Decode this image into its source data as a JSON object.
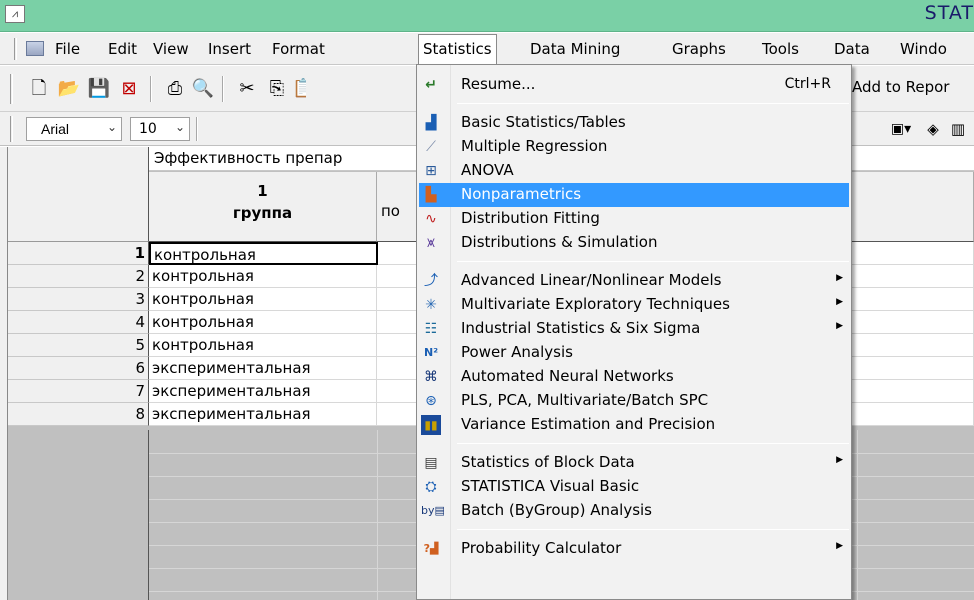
{
  "window": {
    "title": "STAT"
  },
  "menubar": {
    "items": [
      "File",
      "Edit",
      "View",
      "Insert",
      "Format",
      "Statistics",
      "Data Mining",
      "Graphs",
      "Tools",
      "Data",
      "Windo"
    ]
  },
  "toolbar": {
    "add_to_report": "Add to Repor"
  },
  "format_toolbar": {
    "font": "Arial",
    "size": "10"
  },
  "sheet": {
    "title": "Эффективность препар",
    "columns": [
      {
        "number": "1",
        "name": "группа"
      },
      {
        "partial": "по"
      }
    ],
    "rows": [
      {
        "num": "1",
        "value": "контрольная"
      },
      {
        "num": "2",
        "value": "контрольная"
      },
      {
        "num": "3",
        "value": "контрольная"
      },
      {
        "num": "4",
        "value": "контрольная"
      },
      {
        "num": "5",
        "value": "контрольная"
      },
      {
        "num": "6",
        "value": "экспериментальная"
      },
      {
        "num": "7",
        "value": "экспериментальная"
      },
      {
        "num": "8",
        "value": "экспериментальная"
      }
    ]
  },
  "statistics_menu": {
    "items": [
      {
        "label": "Resume...",
        "shortcut": "Ctrl+R",
        "icon": "resume-arrow-icon"
      },
      {
        "label": "Basic Statistics/Tables",
        "icon": "basic-stats-icon"
      },
      {
        "label": "Multiple Regression",
        "icon": "regression-icon"
      },
      {
        "label": "ANOVA",
        "icon": "anova-icon"
      },
      {
        "label": "Nonparametrics",
        "icon": "nonparametrics-icon",
        "highlighted": true
      },
      {
        "label": "Distribution Fitting",
        "icon": "distribution-fitting-icon"
      },
      {
        "label": "Distributions & Simulation",
        "icon": "simulation-icon"
      },
      {
        "label": "Advanced Linear/Nonlinear Models",
        "icon": "advanced-models-icon",
        "submenu": true
      },
      {
        "label": "Multivariate Exploratory Techniques",
        "icon": "multivariate-icon",
        "submenu": true
      },
      {
        "label": "Industrial Statistics & Six Sigma",
        "icon": "industrial-stats-icon",
        "submenu": true
      },
      {
        "label": "Power Analysis",
        "icon": "power-analysis-icon"
      },
      {
        "label": "Automated Neural Networks",
        "icon": "neural-network-icon"
      },
      {
        "label": "PLS, PCA, Multivariate/Batch SPC",
        "icon": "pls-pca-icon"
      },
      {
        "label": "Variance Estimation and Precision",
        "icon": "variance-icon"
      },
      {
        "label": "Statistics of Block Data",
        "icon": "block-data-icon",
        "submenu": true
      },
      {
        "label": "STATISTICA Visual Basic",
        "icon": "visual-basic-icon"
      },
      {
        "label": "Batch (ByGroup) Analysis",
        "icon": "batch-analysis-icon"
      },
      {
        "label": "Probability Calculator",
        "icon": "probability-calculator-icon",
        "submenu": true
      }
    ]
  },
  "colors": {
    "title_bar": "#7ad0a6",
    "highlight": "#3399ff",
    "menu_bg": "#f2f2f2"
  }
}
